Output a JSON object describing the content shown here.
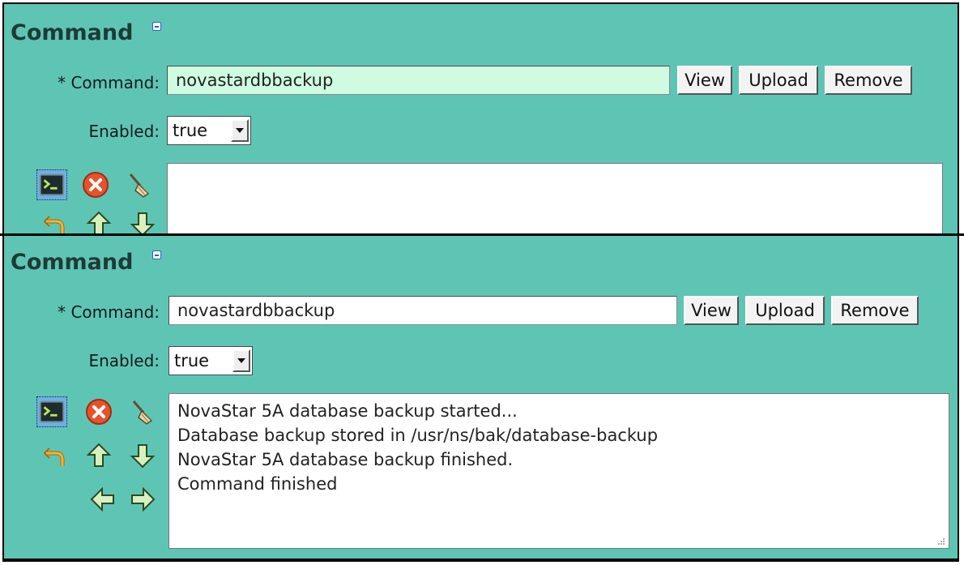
{
  "top": {
    "title": "Command",
    "command_label": "* Command:",
    "command_value": "novastardbbackup",
    "view_label": "View",
    "upload_label": "Upload",
    "remove_label": "Remove",
    "enabled_label": "Enabled:",
    "enabled_value": "true"
  },
  "bottom": {
    "title": "Command",
    "command_label": "* Command:",
    "command_value": "novastardbbackup",
    "view_label": "View",
    "upload_label": "Upload",
    "remove_label": "Remove",
    "enabled_label": "Enabled:",
    "enabled_value": "true",
    "output_lines": [
      "NovaStar 5A database backup started...",
      "Database backup stored in /usr/ns/bak/database-backup",
      "NovaStar 5A database backup finished.",
      "Command finished"
    ]
  },
  "icons": [
    "run-terminal-icon",
    "stop-icon",
    "clear-broom-icon",
    "undo-icon",
    "move-up-icon",
    "move-down-icon",
    "move-left-icon",
    "move-right-icon"
  ],
  "colors": {
    "panel": "#5ec5b5",
    "highlight_input": "#cffbe0",
    "title": "#1f3a36"
  }
}
